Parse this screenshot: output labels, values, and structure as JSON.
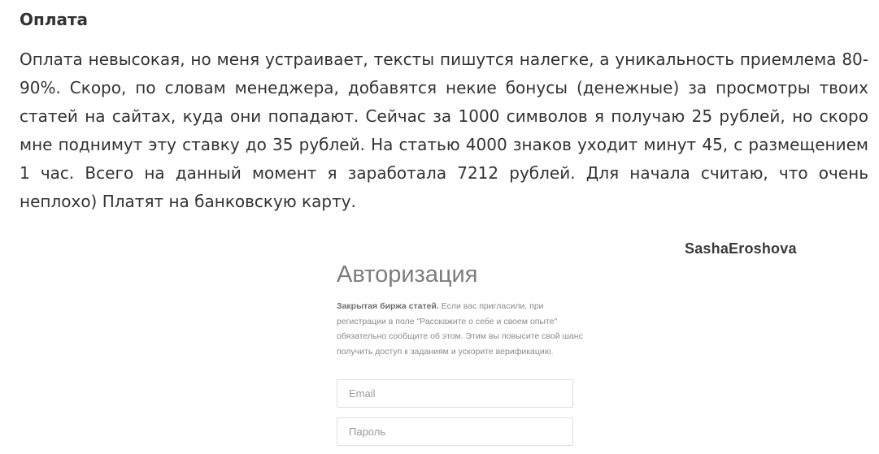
{
  "article": {
    "heading": "Оплата",
    "paragraph": "Оплата невысокая, но меня устраивает, тексты пишутся налегке, а уникальность приемлема 80-90%. Скоро, по словам менеджера, добавятся некие бонусы (денежные) за просмотры твоих статей на сайтах, куда они попадают. Сейчас за 1000 символов я получаю 25 рублей, но скоро мне поднимут эту ставку до 35 рублей. На статью 4000 знаков уходит минут 45, с размещением 1 час. Всего на данный момент я заработала 7212 рублей. Для начала считаю, что очень неплохо) Платят на банковскую карту."
  },
  "screenshot": {
    "watermark": "SashaEroshova",
    "auth": {
      "title": "Авторизация",
      "description_bold": "Закрытая биржа статей.",
      "description_text": " Если вас пригласили, при регистрации в поле \"Расскажите о себе и своем опыте\" обязательно сообщите об этом. Этим вы повысите свой шанс получить доступ к заданиям и ускорите верификацию.",
      "email_placeholder": "Email",
      "password_placeholder": "Пароль"
    }
  }
}
